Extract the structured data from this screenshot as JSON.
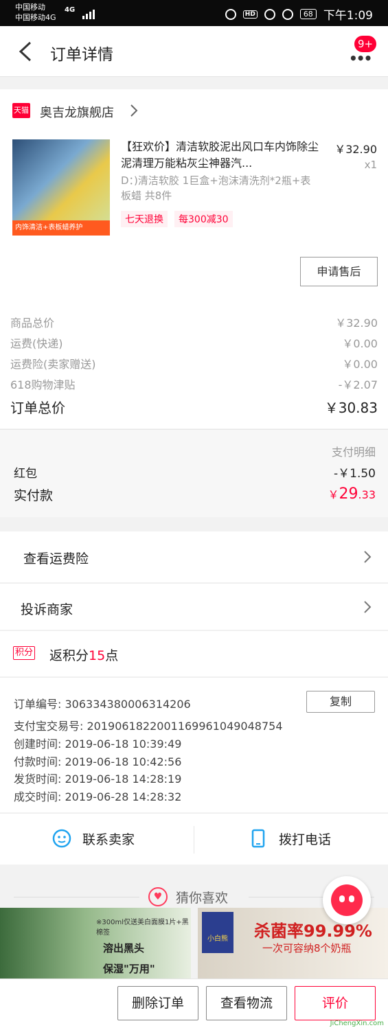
{
  "status_bar": {
    "carrier1": "中国移动",
    "carrier2": "中国移动4G",
    "network": "4G",
    "battery": "68",
    "time": "下午1:09"
  },
  "header": {
    "title": "订单详情",
    "badge": "9+"
  },
  "shop": {
    "logo_text": "天猫",
    "name": "奥吉龙旗舰店"
  },
  "product": {
    "image_tag": "内饰清洁+表板蜡养护",
    "title": "【狂欢价】清洁软胶泥出风口车内饰除尘泥清理万能粘灰尘神器汽...",
    "price": "￥32.90",
    "qty": "x1",
    "spec": "D：)清洁软胶 1巨盒+泡沫清洗剂*2瓶+表板蜡 共8件",
    "tags": [
      "七天退换",
      "每300减30"
    ],
    "after_sale_label": "申请售后"
  },
  "summary": {
    "rows": [
      {
        "label": "商品总价",
        "value": "￥32.90"
      },
      {
        "label": "运费(快递)",
        "value": "￥0.00"
      },
      {
        "label": "运费险(卖家赠送)",
        "value": "￥0.00"
      },
      {
        "label": "618购物津贴",
        "value": "-￥2.07"
      }
    ],
    "total_label": "订单总价",
    "total_value": "￥30.83"
  },
  "payment": {
    "detail_label": "支付明细",
    "redpacket_label": "红包",
    "redpacket_value": "-￥1.50",
    "paid_label": "实付款",
    "paid_currency": "￥",
    "paid_int": "29",
    "paid_dec": ".33"
  },
  "links": {
    "shipping_insurance": "查看运费险",
    "complain": "投诉商家"
  },
  "points": {
    "badge": "积分",
    "prefix": "返积分",
    "value": "15",
    "suffix": "点"
  },
  "order_info": {
    "copy_label": "复制",
    "lines": [
      "订单编号: 306334380006314206",
      "支付宝交易号: 2019061822001169961049048754",
      "创建时间: 2019-06-18 10:39:49",
      "付款时间: 2019-06-18 10:42:56",
      "发货时间: 2019-06-18 14:28:19",
      "成交时间: 2019-06-28 14:28:32"
    ]
  },
  "contact": {
    "seller_label": "联系卖家",
    "phone_label": "拨打电话"
  },
  "guess": {
    "title": "猜你喜欢",
    "rec1_top": "※300ml仅送美白面膜1片+黑棉签",
    "rec1_a": "溶出黑头",
    "rec1_b": "保湿\"万用\"",
    "rec2_logo": "小白熊",
    "rec2_a": "杀菌率99.99%",
    "rec2_b": "一次可容纳8个奶瓶"
  },
  "bottom": {
    "delete_label": "删除订单",
    "logistics_label": "查看物流",
    "review_label": "评价",
    "watermark": "JiChengXin.com"
  },
  "colors": {
    "accent": "#ff0036",
    "gray_text": "#999999",
    "contact_icon": "#1fa3ef"
  }
}
